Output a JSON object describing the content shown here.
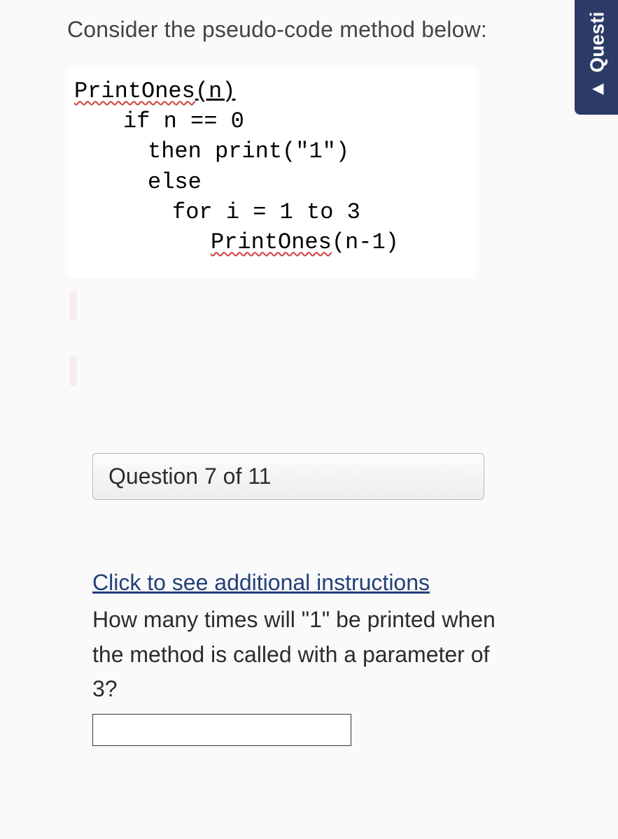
{
  "intro": "Consider the pseudo-code method below:",
  "code": {
    "l1a": "PrintOnes",
    "l1b": "(n)",
    "l2": "if n == 0",
    "l3": "then print(\"1\")",
    "l4": "else",
    "l5": "for i = 1 to 3",
    "l6a": "PrintOnes",
    "l6b": "(n-1)"
  },
  "question_bar": "Question 7 of 11",
  "link_text": "Click to see additional instructions",
  "question_text": "How many times will \"1\" be printed when the method is called with a parameter of 3?",
  "answer_value": "",
  "side_tab_arrow": "▲",
  "side_tab_label": "Questi"
}
